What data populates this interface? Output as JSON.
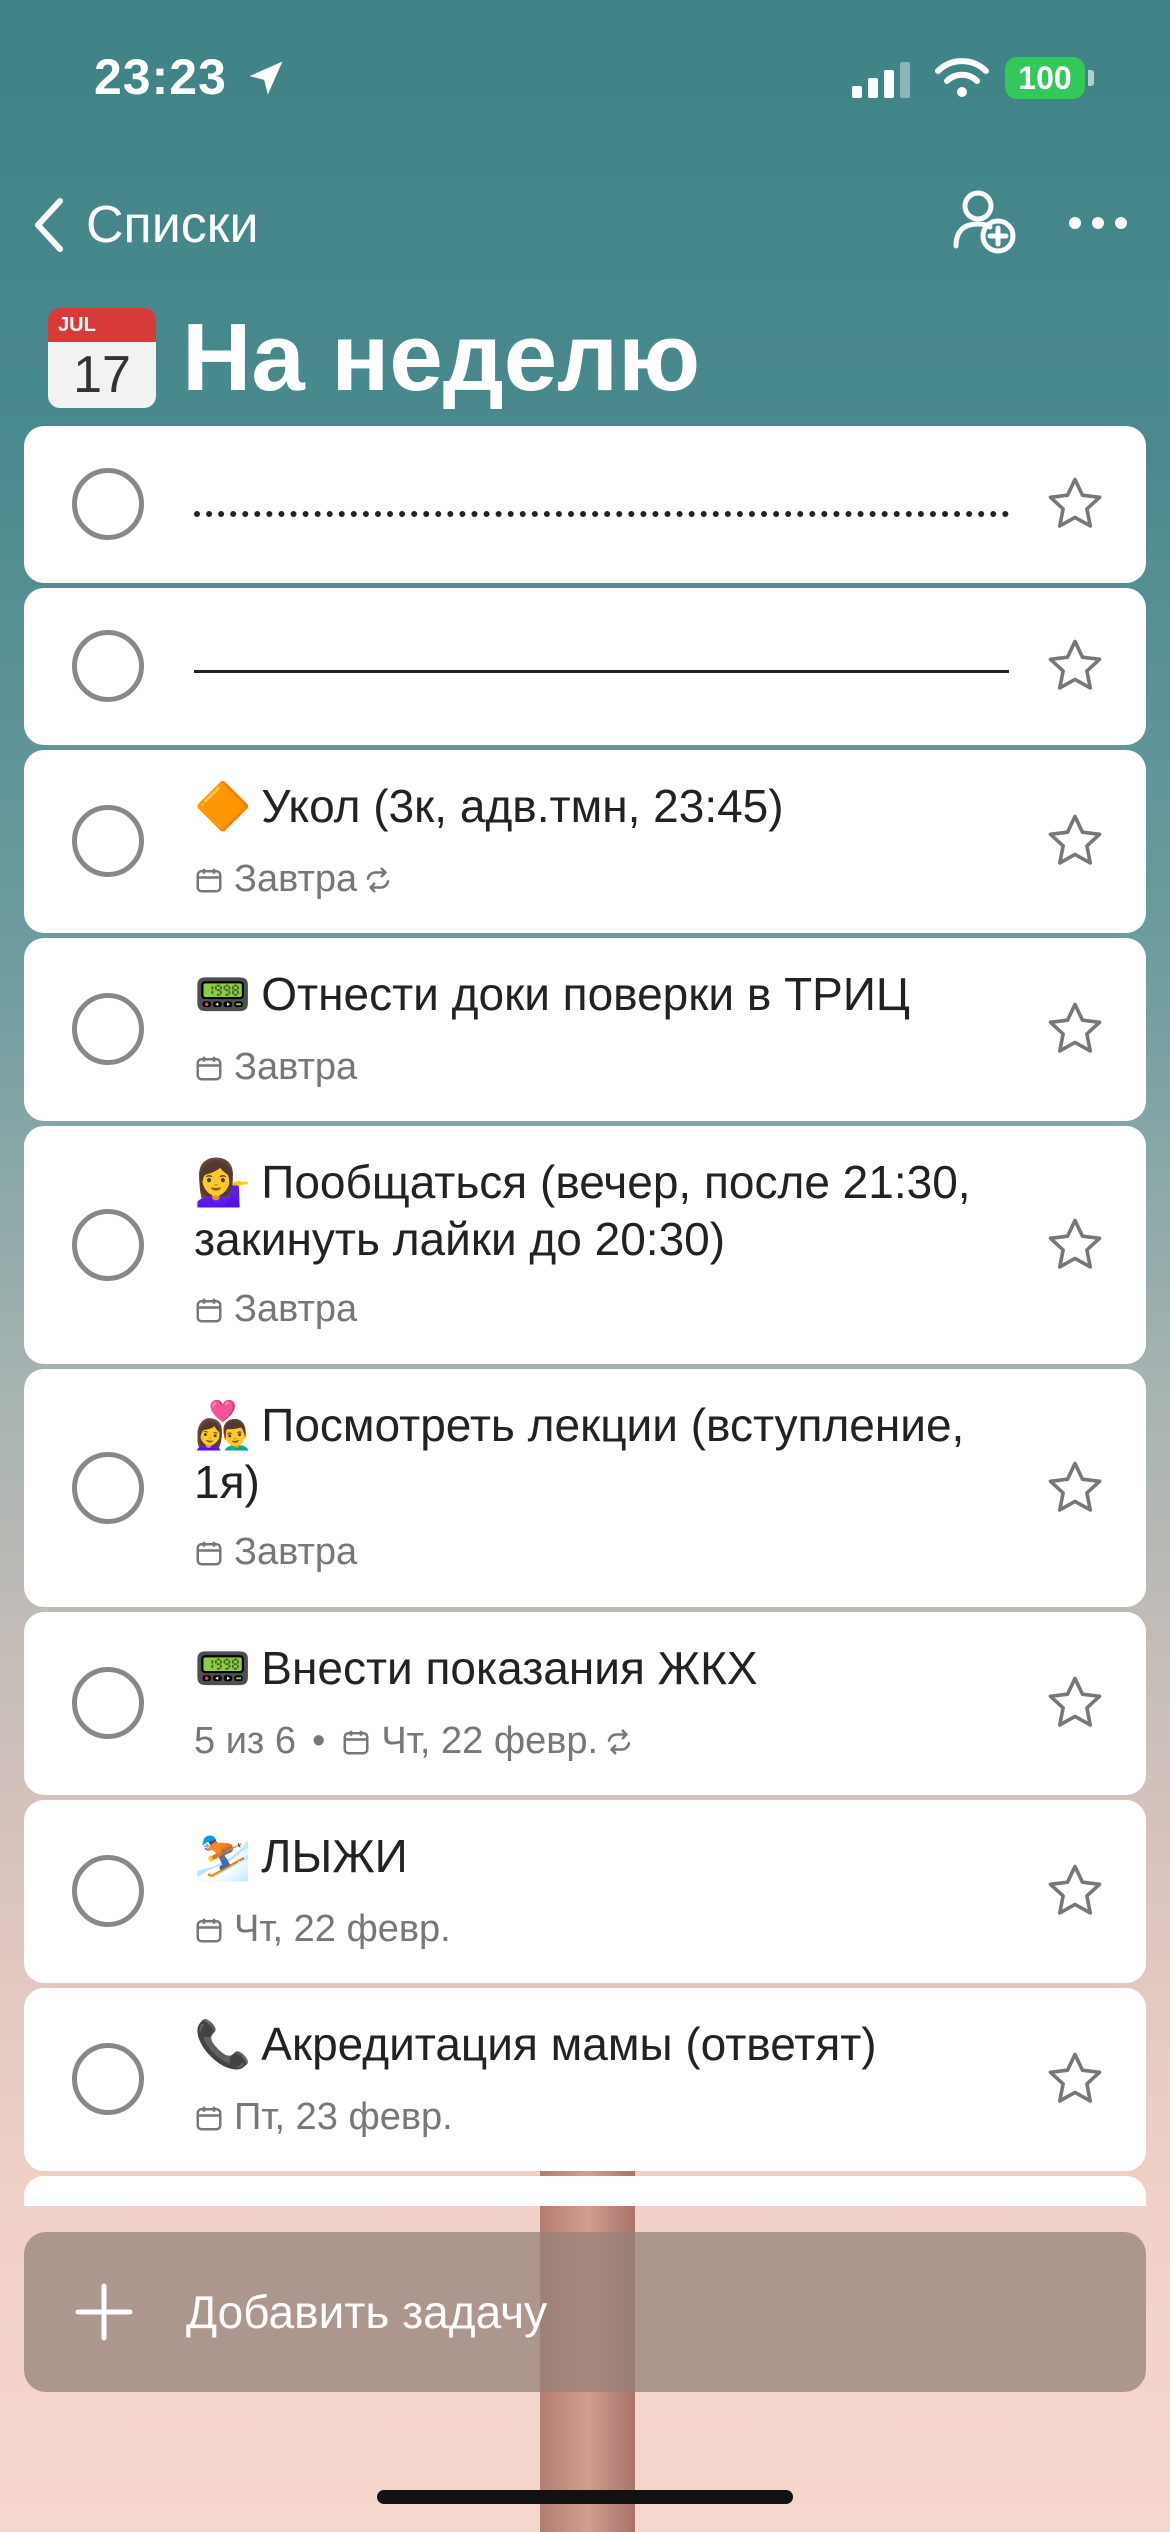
{
  "status_bar": {
    "time": "23:23",
    "battery": "100"
  },
  "nav": {
    "back_label": "Списки"
  },
  "header": {
    "emoji_month": "JUL",
    "emoji_day": "17",
    "title": "На неделю"
  },
  "tasks": [
    {
      "type": "dotted-separator"
    },
    {
      "type": "line-separator"
    },
    {
      "emoji": "🔶",
      "title": "Укол (3к, адв.тмн, 23:45)",
      "date": "Завтра",
      "repeat": true
    },
    {
      "emoji": "📟",
      "title": "Отнести доки поверки в ТРИЦ",
      "date": "Завтра",
      "repeat": false
    },
    {
      "emoji": "💁‍♀️",
      "title": "Пообщаться (вечер, после 21:30, закинуть лайки до 20:30)",
      "date": "Завтра",
      "repeat": false
    },
    {
      "emoji": "👩‍❤️‍👨",
      "title": "Посмотреть лекции (вступление, 1я)",
      "date": "Завтра",
      "repeat": false
    },
    {
      "emoji": "📟",
      "title": "Внести показания ЖКХ",
      "progress": "5 из 6",
      "date": "Чт, 22 февр.",
      "repeat": true
    },
    {
      "emoji": "⛷️",
      "title": "ЛЫЖИ",
      "date": "Чт, 22 февр.",
      "repeat": false
    },
    {
      "emoji": "📞",
      "title": "Акредитация мамы (ответят)",
      "date": "Пт, 23 февр.",
      "repeat": false
    }
  ],
  "add_task": {
    "label": "Добавить задачу"
  },
  "colors": {
    "accent": "#ffffff",
    "battery": "#34c759",
    "meta_text": "#777777"
  }
}
